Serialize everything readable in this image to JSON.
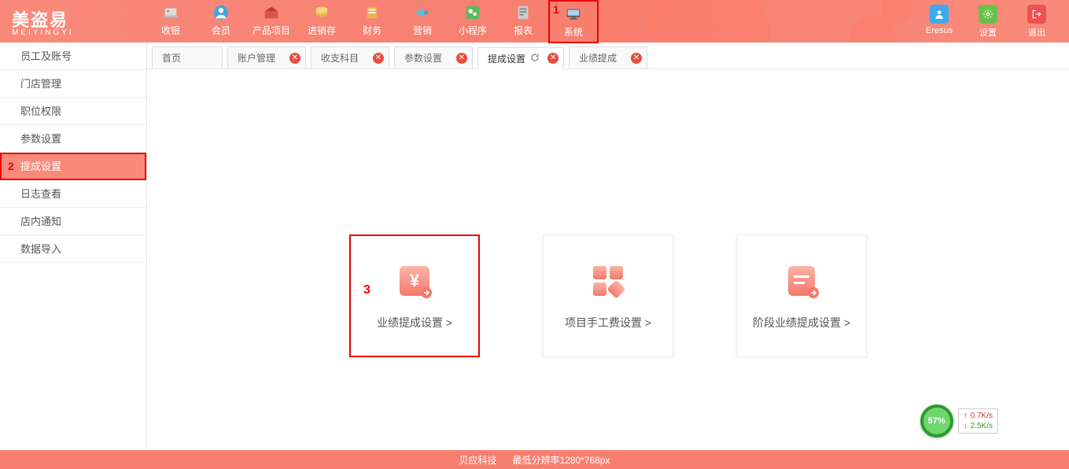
{
  "logo": {
    "main": "美盗易",
    "sub": "MEIYINGYI"
  },
  "nav": [
    {
      "label": "收银",
      "icon": "cashier"
    },
    {
      "label": "会员",
      "icon": "member"
    },
    {
      "label": "产品项目",
      "icon": "product"
    },
    {
      "label": "进销存",
      "icon": "inventory"
    },
    {
      "label": "财务",
      "icon": "finance"
    },
    {
      "label": "营销",
      "icon": "marketing"
    },
    {
      "label": "小程序",
      "icon": "wechat"
    },
    {
      "label": "报表",
      "icon": "report"
    },
    {
      "label": "系统",
      "icon": "system",
      "marker": "1",
      "highlighted": true
    }
  ],
  "header_right": [
    {
      "label": "Eresus",
      "icon": "user",
      "color": "blue"
    },
    {
      "label": "设置",
      "icon": "gear",
      "color": "green"
    },
    {
      "label": "退出",
      "icon": "exit",
      "color": "red"
    }
  ],
  "sidebar": [
    {
      "label": "员工及账号"
    },
    {
      "label": "门店管理"
    },
    {
      "label": "职位权限"
    },
    {
      "label": "参数设置"
    },
    {
      "label": "提成设置",
      "active": true,
      "marker": "2",
      "highlighted": true
    },
    {
      "label": "日志查看"
    },
    {
      "label": "店内通知"
    },
    {
      "label": "数据导入"
    }
  ],
  "tabs": [
    {
      "label": "首页",
      "closable": false
    },
    {
      "label": "账户管理",
      "closable": true
    },
    {
      "label": "收支科目",
      "closable": true
    },
    {
      "label": "参数设置",
      "closable": true
    },
    {
      "label": "提成设置",
      "closable": true,
      "refresh": true,
      "active": true
    },
    {
      "label": "业绩提成",
      "closable": true
    }
  ],
  "cards": [
    {
      "label": "业绩提成设置 >",
      "icon": "yen",
      "marker": "3",
      "highlighted": true
    },
    {
      "label": "项目手工费设置 >",
      "icon": "tiles"
    },
    {
      "label": "阶段业绩提成设置 >",
      "icon": "doc"
    }
  ],
  "footer": {
    "company": "贝应科技",
    "resolution": "最低分辨率1280*768px"
  },
  "network": {
    "percent": "57%",
    "up": "0.7K/s",
    "down": "2.5K/s"
  }
}
